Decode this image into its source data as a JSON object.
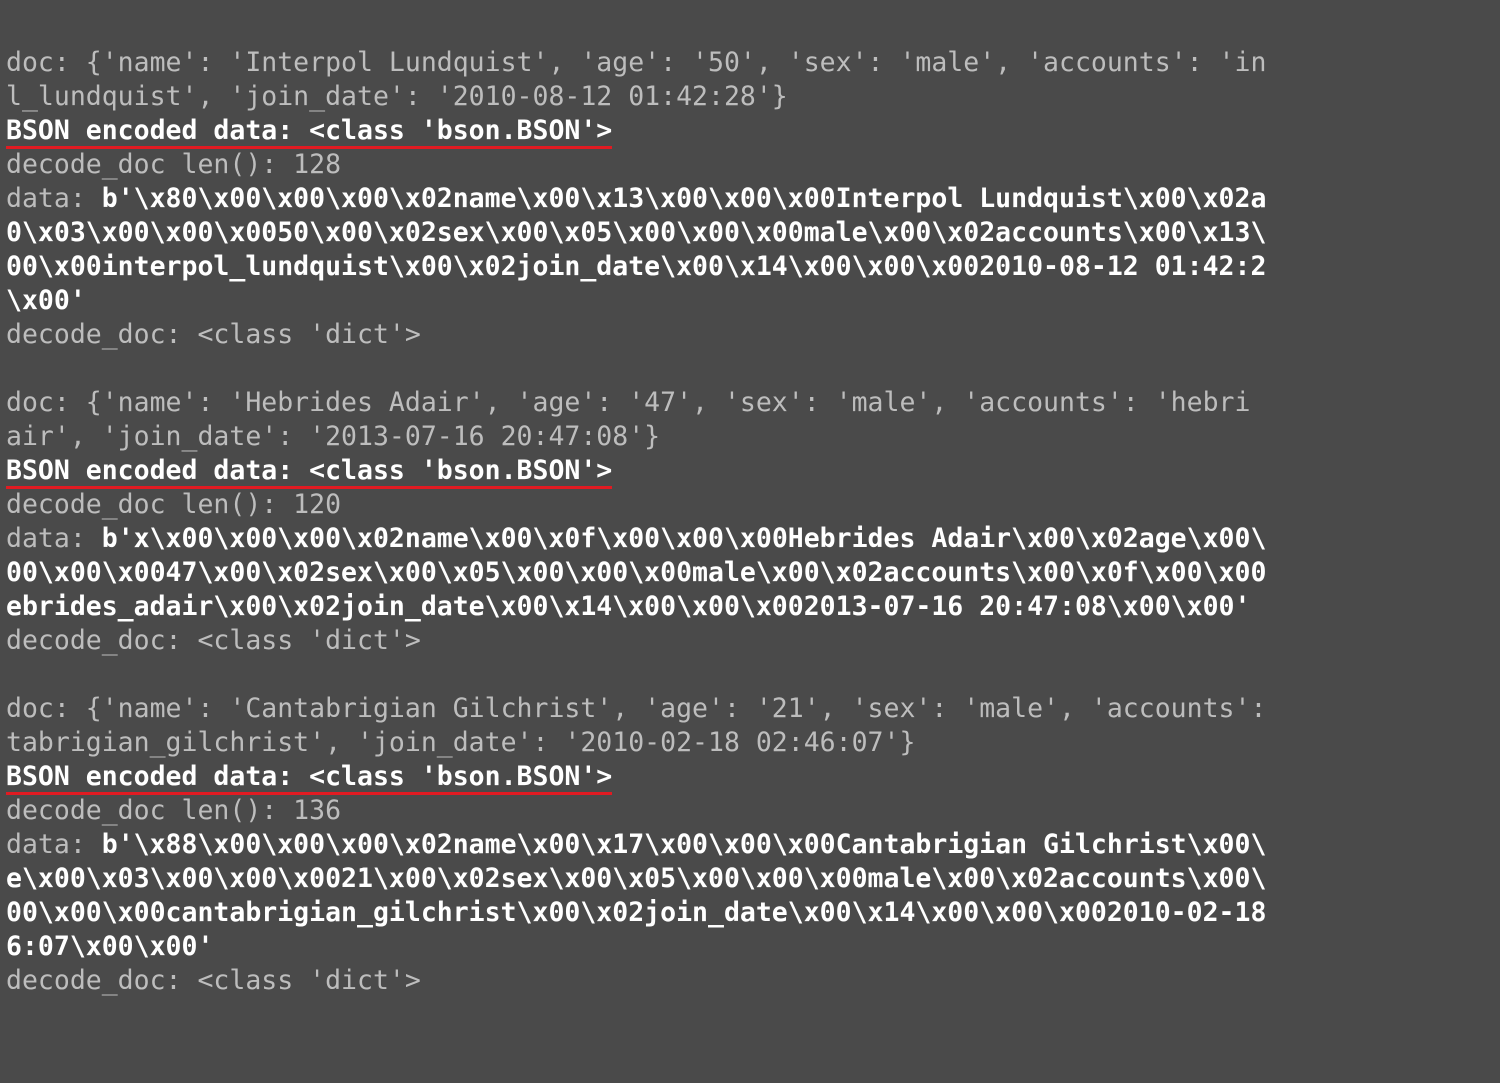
{
  "blocks": [
    {
      "doc_line": "doc: {'name': 'Interpol Lundquist', 'age': '50', 'sex': 'male', 'accounts': 'in",
      "doc_line2": "l_lundquist', 'join_date': '2010-08-12 01:42:28'}",
      "encoded_line": "BSON encoded data: <class 'bson.BSON'>",
      "len_line": "decode_doc len(): 128",
      "data_prefix": "data: ",
      "data_body": "b'\\x80\\x00\\x00\\x00\\x02name\\x00\\x13\\x00\\x00\\x00Interpol Lundquist\\x00\\x02a\n0\\x03\\x00\\x00\\x0050\\x00\\x02sex\\x00\\x05\\x00\\x00\\x00male\\x00\\x02accounts\\x00\\x13\\\n00\\x00interpol_lundquist\\x00\\x02join_date\\x00\\x14\\x00\\x00\\x002010-08-12 01:42:2\n\\x00'",
      "decode_line": "decode_doc: <class 'dict'>"
    },
    {
      "doc_line": "doc: {'name': 'Hebrides Adair', 'age': '47', 'sex': 'male', 'accounts': 'hebri",
      "doc_line2": "air', 'join_date': '2013-07-16 20:47:08'}",
      "encoded_line": "BSON encoded data: <class 'bson.BSON'>",
      "len_line": "decode_doc len(): 120",
      "data_prefix": "data: ",
      "data_body": "b'x\\x00\\x00\\x00\\x02name\\x00\\x0f\\x00\\x00\\x00Hebrides Adair\\x00\\x02age\\x00\\\n00\\x00\\x0047\\x00\\x02sex\\x00\\x05\\x00\\x00\\x00male\\x00\\x02accounts\\x00\\x0f\\x00\\x00\nebrides_adair\\x00\\x02join_date\\x00\\x14\\x00\\x00\\x002013-07-16 20:47:08\\x00\\x00'",
      "decode_line": "decode_doc: <class 'dict'>"
    },
    {
      "doc_line": "doc: {'name': 'Cantabrigian Gilchrist', 'age': '21', 'sex': 'male', 'accounts':",
      "doc_line2": "tabrigian_gilchrist', 'join_date': '2010-02-18 02:46:07'}",
      "encoded_line": "BSON encoded data: <class 'bson.BSON'>",
      "len_line": "decode_doc len(): 136",
      "data_prefix": "data: ",
      "data_body": "b'\\x88\\x00\\x00\\x00\\x02name\\x00\\x17\\x00\\x00\\x00Cantabrigian Gilchrist\\x00\\\ne\\x00\\x03\\x00\\x00\\x0021\\x00\\x02sex\\x00\\x05\\x00\\x00\\x00male\\x00\\x02accounts\\x00\\\n00\\x00\\x00cantabrigian_gilchrist\\x00\\x02join_date\\x00\\x14\\x00\\x00\\x002010-02-18\n6:07\\x00\\x00'",
      "decode_line": "decode_doc: <class 'dict'>"
    }
  ]
}
